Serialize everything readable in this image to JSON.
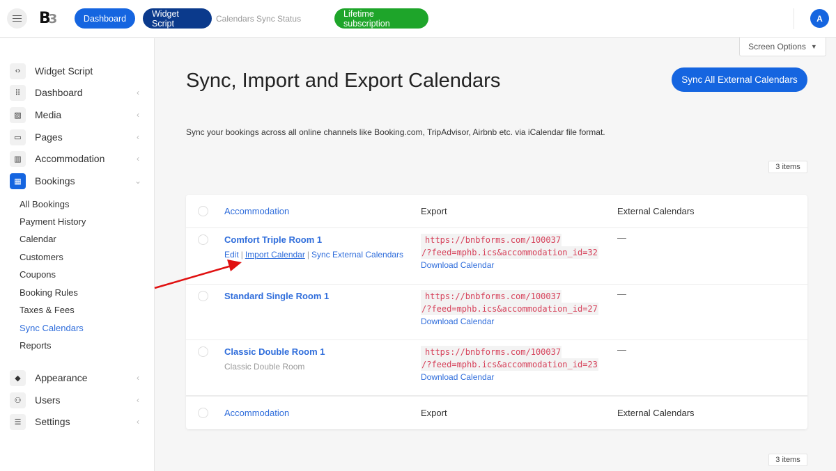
{
  "topbar": {
    "menu_icon": "hamburger-icon",
    "logo_main": "B",
    "logo_secondary": "3",
    "dashboard_label": "Dashboard",
    "widget_script_label": "Widget Script",
    "sync_status_label": "Calendars Sync Status",
    "lifetime_label": "Lifetime subscription",
    "avatar_initial": "A",
    "colors": {
      "primary": "#1565e0",
      "dark": "#0b3a8c",
      "success": "#1ea52a"
    }
  },
  "sidebar": {
    "items": [
      {
        "label": "Widget Script",
        "icon": "code-icon",
        "glyph": "‹›",
        "has_chevron": false
      },
      {
        "label": "Dashboard",
        "icon": "grid-icon",
        "glyph": "⠿",
        "has_chevron": true,
        "chevron": "‹"
      },
      {
        "label": "Media",
        "icon": "image-icon",
        "glyph": "▨",
        "has_chevron": true,
        "chevron": "‹"
      },
      {
        "label": "Pages",
        "icon": "pages-icon",
        "glyph": "▭",
        "has_chevron": true,
        "chevron": "‹"
      },
      {
        "label": "Accommodation",
        "icon": "building-icon",
        "glyph": "▥",
        "has_chevron": true,
        "chevron": "‹"
      },
      {
        "label": "Bookings",
        "icon": "calendar-icon",
        "glyph": "▦",
        "has_chevron": true,
        "chevron": "⌄",
        "active": true
      },
      {
        "label": "Appearance",
        "icon": "paint-bucket-icon",
        "glyph": "◆",
        "has_chevron": true,
        "chevron": "‹"
      },
      {
        "label": "Users",
        "icon": "users-icon",
        "glyph": "⚇",
        "has_chevron": true,
        "chevron": "‹"
      },
      {
        "label": "Settings",
        "icon": "sliders-icon",
        "glyph": "☰",
        "has_chevron": true,
        "chevron": "‹"
      }
    ],
    "bookings_submenu": [
      "All Bookings",
      "Payment History",
      "Calendar",
      "Customers",
      "Coupons",
      "Booking Rules",
      "Taxes & Fees",
      "Sync Calendars",
      "Reports"
    ],
    "active_submenu": "Sync Calendars"
  },
  "main": {
    "screen_options_label": "Screen Options",
    "screen_options_caret": "▼",
    "title": "Sync, Import and Export Calendars",
    "sync_all_label": "Sync All External Calendars",
    "description": "Sync your bookings across all online channels like Booking.com, TripAdvisor, Airbnb etc. via iCalendar file format.",
    "items_count": "3 items",
    "table": {
      "columns": [
        "Accommodation",
        "Export",
        "External Calendars"
      ],
      "rows": [
        {
          "name": "Comfort Triple Room 1",
          "subtitle": "",
          "actions": [
            "Edit",
            "Import Calendar",
            "Sync External Calendars"
          ],
          "export_url_line1": "https://bnbforms.com/100037",
          "export_url_line2": "/?feed=mphb.ics&accommodation_id=32",
          "download_label": "Download Calendar",
          "external": "—"
        },
        {
          "name": "Standard Single Room 1",
          "subtitle": "",
          "actions": [],
          "export_url_line1": "https://bnbforms.com/100037",
          "export_url_line2": "/?feed=mphb.ics&accommodation_id=27",
          "download_label": "Download Calendar",
          "external": "—"
        },
        {
          "name": "Classic Double Room 1",
          "subtitle": "Classic Double Room",
          "actions": [],
          "export_url_line1": "https://bnbforms.com/100037",
          "export_url_line2": "/?feed=mphb.ics&accommodation_id=23",
          "download_label": "Download Calendar",
          "external": "—"
        }
      ],
      "action_separator": "|"
    }
  },
  "annotation": {
    "type": "red-arrow",
    "points_to": "Import Calendar",
    "color": "#e01010"
  }
}
